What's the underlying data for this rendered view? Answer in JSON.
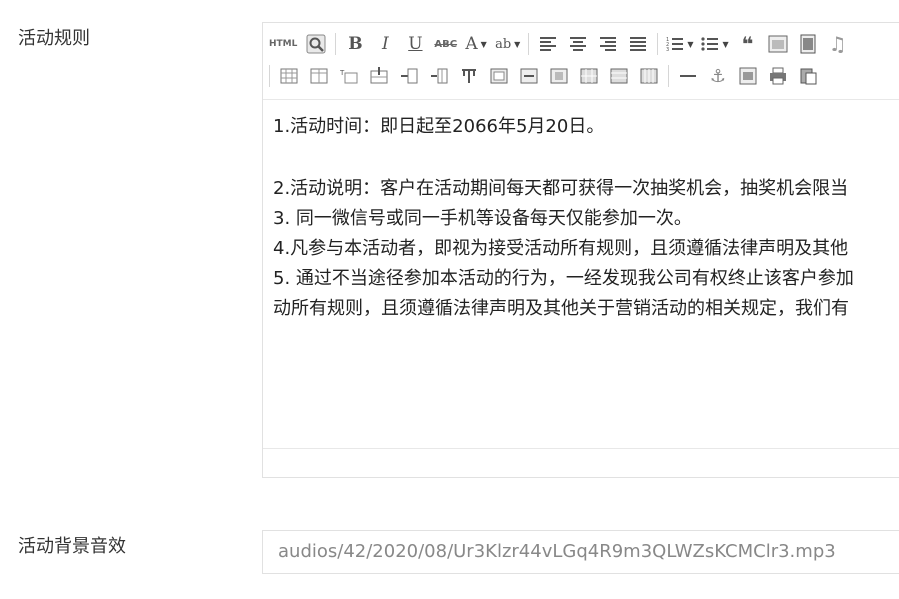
{
  "labels": {
    "rules": "活动规则",
    "audio": "活动背景音效"
  },
  "editor": {
    "toolbar": {
      "html_label": "HTML",
      "bold": "B",
      "italic": "I",
      "underline": "U",
      "strike": "ABC",
      "font": "A",
      "spell": "ab"
    },
    "content": {
      "p1": "1.活动时间：即日起至2066年5月20日。",
      "p2": "2.活动说明：客户在活动期间每天都可获得一次抽奖机会，抽奖机会限当",
      "p3": "3. 同一微信号或同一手机等设备每天仅能参加一次。",
      "p4": "4.凡参与本活动者，即视为接受活动所有规则，且须遵循法律声明及其他",
      "p5a": "5. 通过不当途径参加本活动的行为，一经发现我公司有权终止该客户参加",
      "p5b": "动所有规则，且须遵循法律声明及其他关于营销活动的相关规定，我们有"
    }
  },
  "audio": {
    "value": "audios/42/2020/08/Ur3Klzr44vLGq4R9m3QLWZsKCMClr3.mp3"
  },
  "colors": {
    "border": "#e1e1e1",
    "icon": "#555555",
    "text": "#222222",
    "muted": "#888888"
  }
}
